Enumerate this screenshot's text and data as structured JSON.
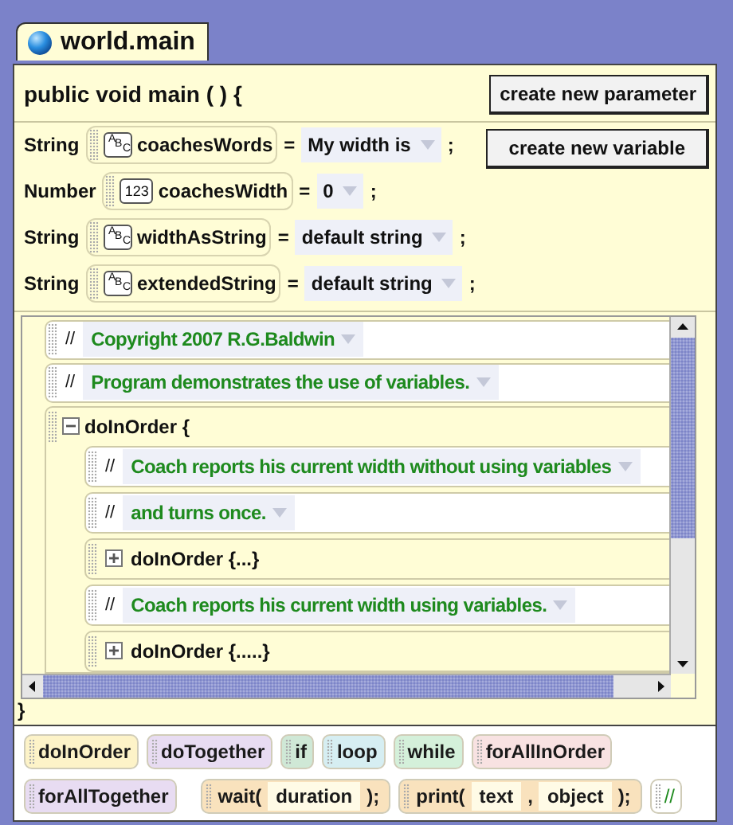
{
  "tab": {
    "title": "world.main",
    "selected": true
  },
  "method": {
    "signature": "public void main ( ) {",
    "closing": "}"
  },
  "buttons": [
    "create new parameter",
    "create new variable"
  ],
  "variables": [
    {
      "type": "String",
      "kind": "string",
      "icon_text": "ABC",
      "name": "coachesWords",
      "equals": "=",
      "value": "My width is",
      "end": ";"
    },
    {
      "type": "Number",
      "kind": "number",
      "icon_text": "123",
      "name": "coachesWidth",
      "equals": "=",
      "value": "0",
      "end": ";"
    },
    {
      "type": "String",
      "kind": "string",
      "icon_text": "ABC",
      "name": "widthAsString",
      "equals": "=",
      "value": "default string",
      "end": ";"
    },
    {
      "type": "String",
      "kind": "string",
      "icon_text": "ABC",
      "name": "extendedString",
      "equals": "=",
      "value": "default string",
      "end": ";"
    }
  ],
  "code": [
    {
      "kind": "comment",
      "mark": "//",
      "text": "Copyright 2007 R.G.Baldwin"
    },
    {
      "kind": "comment",
      "mark": "//",
      "text": "Program demonstrates the use of variables."
    },
    {
      "kind": "block",
      "label": "doInOrder {",
      "expanded": true,
      "children": [
        {
          "kind": "comment",
          "mark": "//",
          "text": "Coach reports his current width without using variables"
        },
        {
          "kind": "comment",
          "mark": "//",
          "text": "and turns once."
        },
        {
          "kind": "block",
          "label": "doInOrder {...}",
          "expanded": false
        },
        {
          "kind": "comment",
          "mark": "//",
          "text": "Coach reports his current width using variables."
        },
        {
          "kind": "block",
          "label": "doInOrder {.....}",
          "expanded": false
        }
      ]
    }
  ],
  "palette": [
    [
      {
        "kind": "block",
        "label": "doInOrder",
        "color": "#fdf3c8"
      },
      {
        "kind": "block",
        "label": "doTogether",
        "color": "#e8dcf2"
      },
      {
        "kind": "block",
        "label": "if",
        "color": "#cfe8d6"
      },
      {
        "kind": "block",
        "label": "loop",
        "color": "#d6eef2"
      },
      {
        "kind": "block",
        "label": "while",
        "color": "#d4f0da"
      },
      {
        "kind": "block",
        "label": "forAllInOrder",
        "color": "#f8e2e2"
      }
    ],
    [
      {
        "kind": "block",
        "label": "forAllTogether",
        "color": "#e8dcf2"
      },
      {
        "kind": "call",
        "name": "wait(",
        "params": [
          "duration"
        ],
        "end": ");",
        "color": "#f9e2bd"
      },
      {
        "kind": "call",
        "name": "print(",
        "params": [
          "text",
          "object"
        ],
        "separators": [
          ","
        ],
        "end": ");",
        "color": "#f9e2bd"
      },
      {
        "kind": "comment",
        "label": "//",
        "color": "#ffffff"
      }
    ]
  ]
}
